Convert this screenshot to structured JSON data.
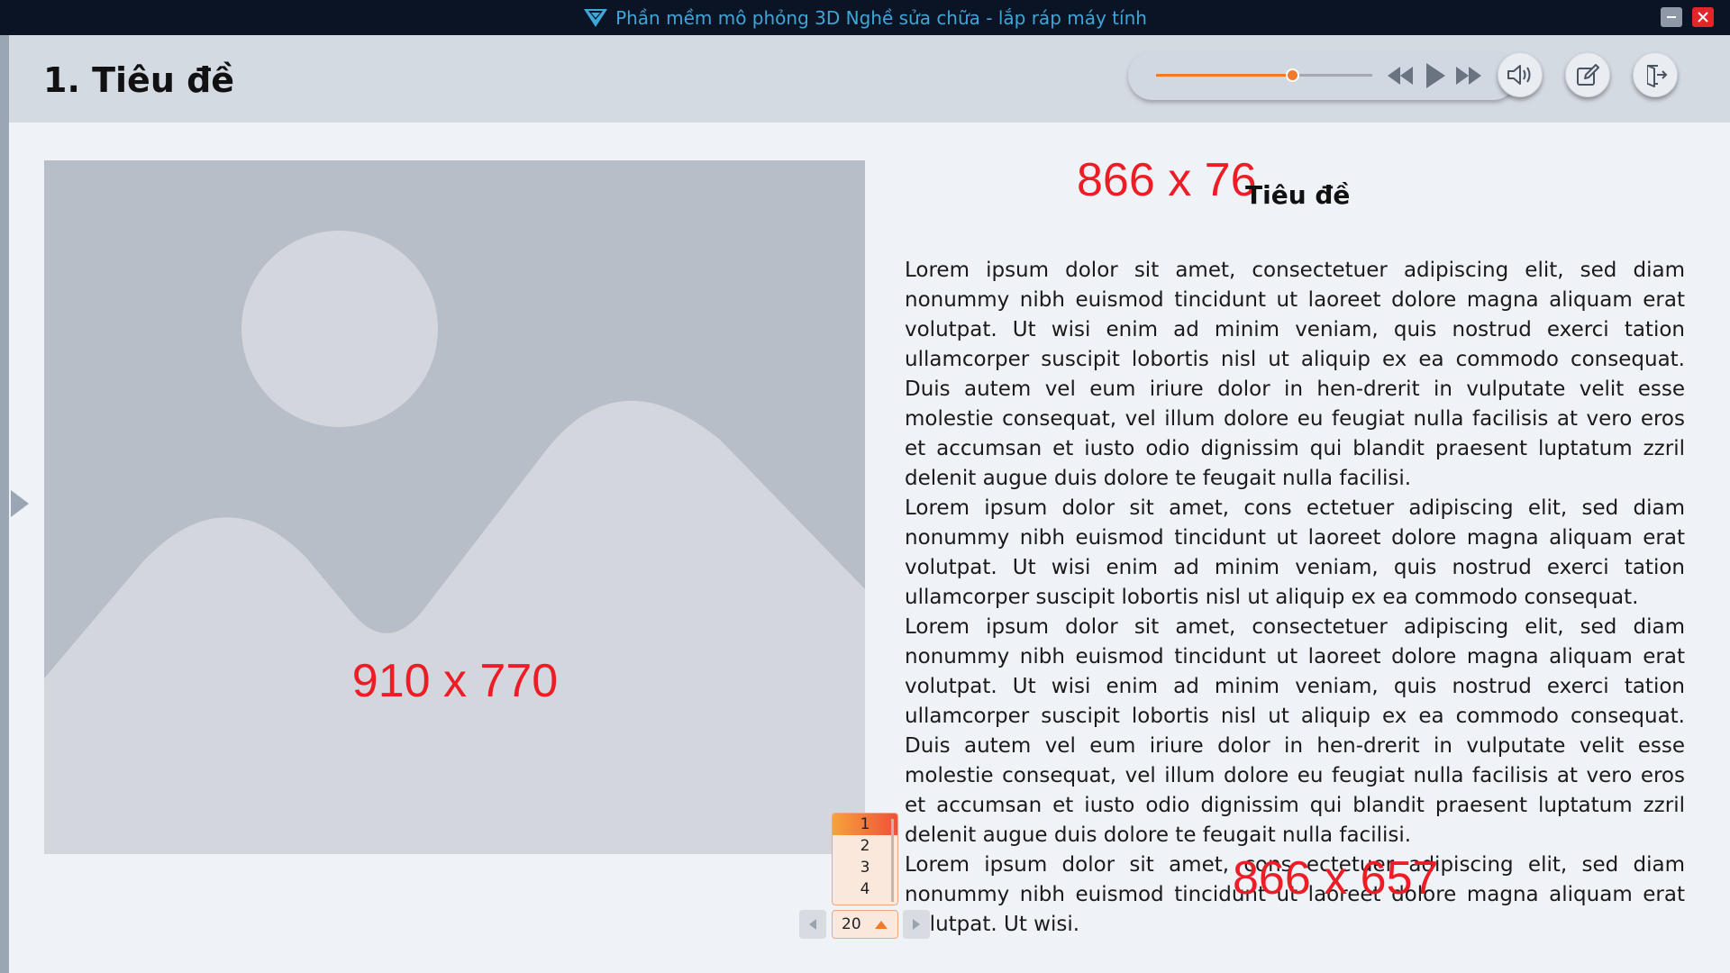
{
  "window": {
    "title": "Phần mềm mô phỏng 3D Nghề sửa chữa - lắp ráp máy tính",
    "minimize_icon": "minimize-icon",
    "close_icon": "close-icon",
    "accent_color": "#3fa6d8"
  },
  "header": {
    "title": "1.  Tiêu đề"
  },
  "media": {
    "progress": 0.63,
    "progress_color": "#f07a2a",
    "icons": [
      "rewind-icon",
      "play-icon",
      "fast-forward-icon",
      "volume-icon",
      "edit-icon",
      "exit-icon"
    ]
  },
  "content": {
    "image_size_label": "910 x 770",
    "title_size_label": "866 x 76",
    "title": "Tiêu đề",
    "text_size_label": "866 x 657",
    "paragraphs": [
      "Lorem ipsum dolor sit amet, consectetuer adipiscing elit, sed diam nonummy nibh euismod tincidunt ut laoreet dolore magna aliquam erat volutpat. Ut wisi enim ad minim veniam, quis nostrud exerci tation ullamcorper suscipit lobortis nisl ut aliquip ex ea commodo consequat. Duis autem vel eum iriure dolor in hen-drerit in vulputate velit esse molestie consequat, vel illum dolore eu feugiat nulla facilisis at vero eros et accumsan et iusto odio dignissim qui blandit praesent luptatum zzril delenit augue duis dolore te feugait nulla facilisi.",
      "Lorem ipsum dolor sit amet, cons ectetuer adipiscing elit, sed diam nonummy nibh euismod tincidunt ut laoreet dolore magna aliquam erat volutpat. Ut wisi enim ad minim veniam, quis nostrud exerci tation ullamcorper suscipit lobortis nisl ut aliquip ex ea commodo consequat.",
      "Lorem ipsum dolor sit amet, consectetuer adipiscing elit, sed diam nonummy nibh euismod tincidunt ut laoreet dolore magna aliquam erat volutpat. Ut wisi enim ad minim veniam, quis nostrud exerci tation ullamcorper suscipit lobortis nisl ut aliquip ex ea commodo consequat. Duis autem vel eum iriure dolor in hen-drerit in vulputate velit esse molestie consequat, vel illum dolore eu feugiat nulla facilisis at vero eros et accumsan et iusto odio dignissim qui blandit praesent luptatum zzril delenit augue duis dolore te feugait nulla facilisi.",
      "Lorem ipsum dolor sit amet, cons ectetuer adipiscing elit, sed diam nonummy nibh euismod tincidunt ut laoreet dolore magna aliquam erat volutpat. Ut wisi."
    ]
  },
  "pager": {
    "options": [
      "1",
      "2",
      "3",
      "4"
    ],
    "selected_option": "1",
    "current": "20"
  }
}
